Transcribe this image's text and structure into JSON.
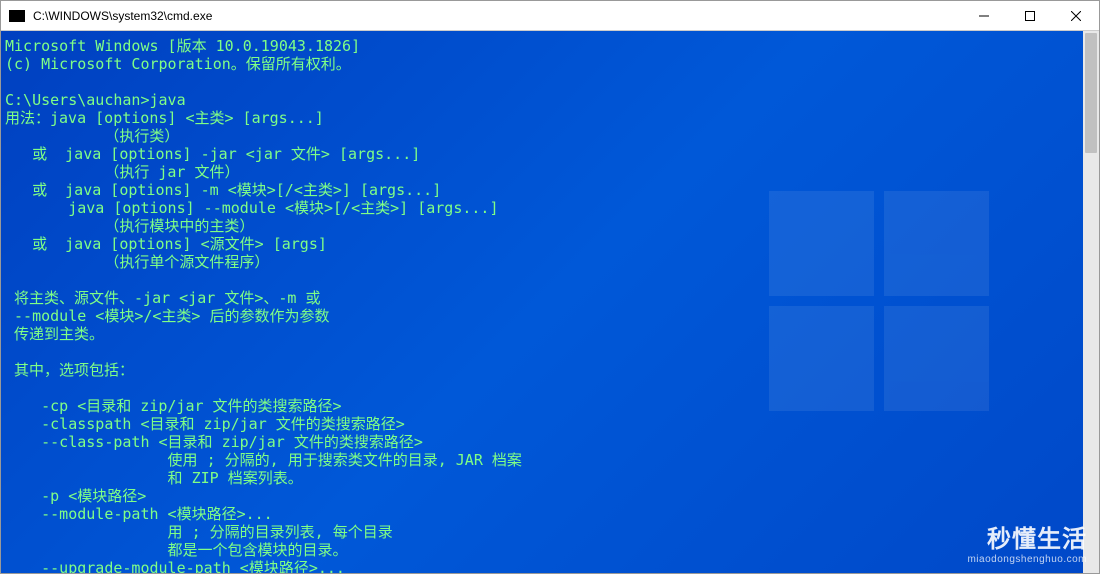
{
  "window": {
    "title": "C:\\WINDOWS\\system32\\cmd.exe",
    "controls": {
      "minimize": "min",
      "maximize": "max",
      "close": "close"
    }
  },
  "prompt": {
    "cwd": "C:\\Users\\auchan",
    "command": "java"
  },
  "term": {
    "lines": [
      "Microsoft Windows [版本 10.0.19043.1826]",
      "(c) Microsoft Corporation。保留所有权利。",
      "",
      "C:\\Users\\auchan>java",
      "用法：java [options] <主类> [args...]",
      "           （执行类）",
      "   或  java [options] -jar <jar 文件> [args...]",
      "           （执行 jar 文件）",
      "   或  java [options] -m <模块>[/<主类>] [args...]",
      "       java [options] --module <模块>[/<主类>] [args...]",
      "           （执行模块中的主类）",
      "   或  java [options] <源文件> [args]",
      "           （执行单个源文件程序）",
      "",
      " 将主类、源文件、-jar <jar 文件>、-m 或",
      " --module <模块>/<主类> 后的参数作为参数",
      " 传递到主类。",
      "",
      " 其中，选项包括：",
      "",
      "    -cp <目录和 zip/jar 文件的类搜索路径>",
      "    -classpath <目录和 zip/jar 文件的类搜索路径>",
      "    --class-path <目录和 zip/jar 文件的类搜索路径>",
      "                  使用 ; 分隔的, 用于搜索类文件的目录, JAR 档案",
      "                  和 ZIP 档案列表。",
      "    -p <模块路径>",
      "    --module-path <模块路径>...",
      "                  用 ; 分隔的目录列表, 每个目录",
      "                  都是一个包含模块的目录。",
      "    --upgrade-module-path <模块路径>..."
    ]
  },
  "watermark": {
    "brand": "秒懂生活",
    "url": "miaodongshenghuo.com"
  }
}
